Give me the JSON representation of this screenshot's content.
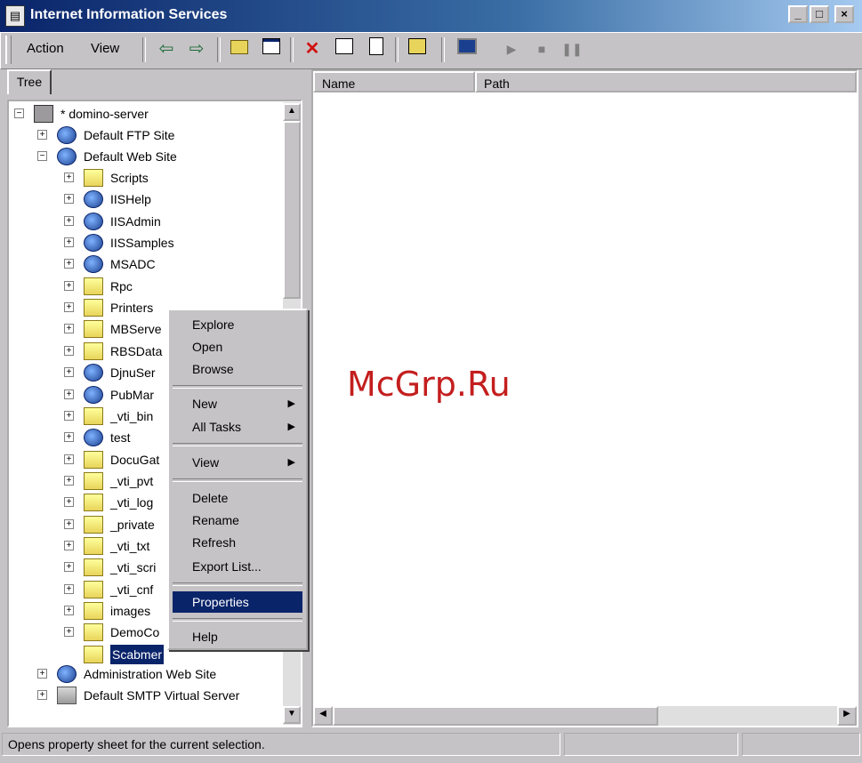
{
  "window": {
    "title": "Internet Information Services",
    "app_icon": "iis-icon"
  },
  "caption_buttons": {
    "minimize": "_",
    "maximize": "□",
    "close": "×"
  },
  "menu": {
    "action": "Action",
    "view": "View"
  },
  "toolbar_icons": [
    "back-arrow-icon",
    "forward-arrow-icon",
    "up-folder-icon",
    "show-tree-icon",
    "delete-icon",
    "properties-icon",
    "export-icon",
    "new-window-icon",
    "computer-icon",
    "start-icon",
    "stop-icon",
    "pause-icon"
  ],
  "tree": {
    "tab_label": "Tree",
    "root": "* domino-server",
    "ftp": "Default FTP Site",
    "web": "Default Web Site",
    "children": [
      "Scripts",
      "IISHelp",
      "IISAdmin",
      "IISSamples",
      "MSADC",
      "Rpc",
      "Printers",
      "MBServe",
      "RBSData",
      "DjnuSer",
      "PubMar",
      "_vti_bin",
      "test",
      "DocuGat",
      "_vti_pvt",
      "_vti_log",
      "_private",
      "_vti_txt",
      "_vti_scri",
      "_vti_cnf",
      "images",
      "DemoCo",
      "Scabmer"
    ],
    "admin": "Administration Web Site",
    "smtp": "Default SMTP Virtual Server"
  },
  "list": {
    "col_name": "Name",
    "col_path": "Path"
  },
  "watermark": "McGrp.Ru",
  "context_menu": {
    "explore": "Explore",
    "open": "Open",
    "browse": "Browse",
    "new": "New",
    "all_tasks": "All Tasks",
    "view": "View",
    "delete": "Delete",
    "rename": "Rename",
    "refresh": "Refresh",
    "export": "Export List...",
    "properties": "Properties",
    "help": "Help",
    "submenu_arrow": "▶"
  },
  "status": {
    "text": "Opens property sheet for the current selection."
  },
  "colors": {
    "title_start": "#0a246a",
    "title_end": "#a6caf0",
    "selection": "#0a246a",
    "watermark": "#c41e1e"
  }
}
